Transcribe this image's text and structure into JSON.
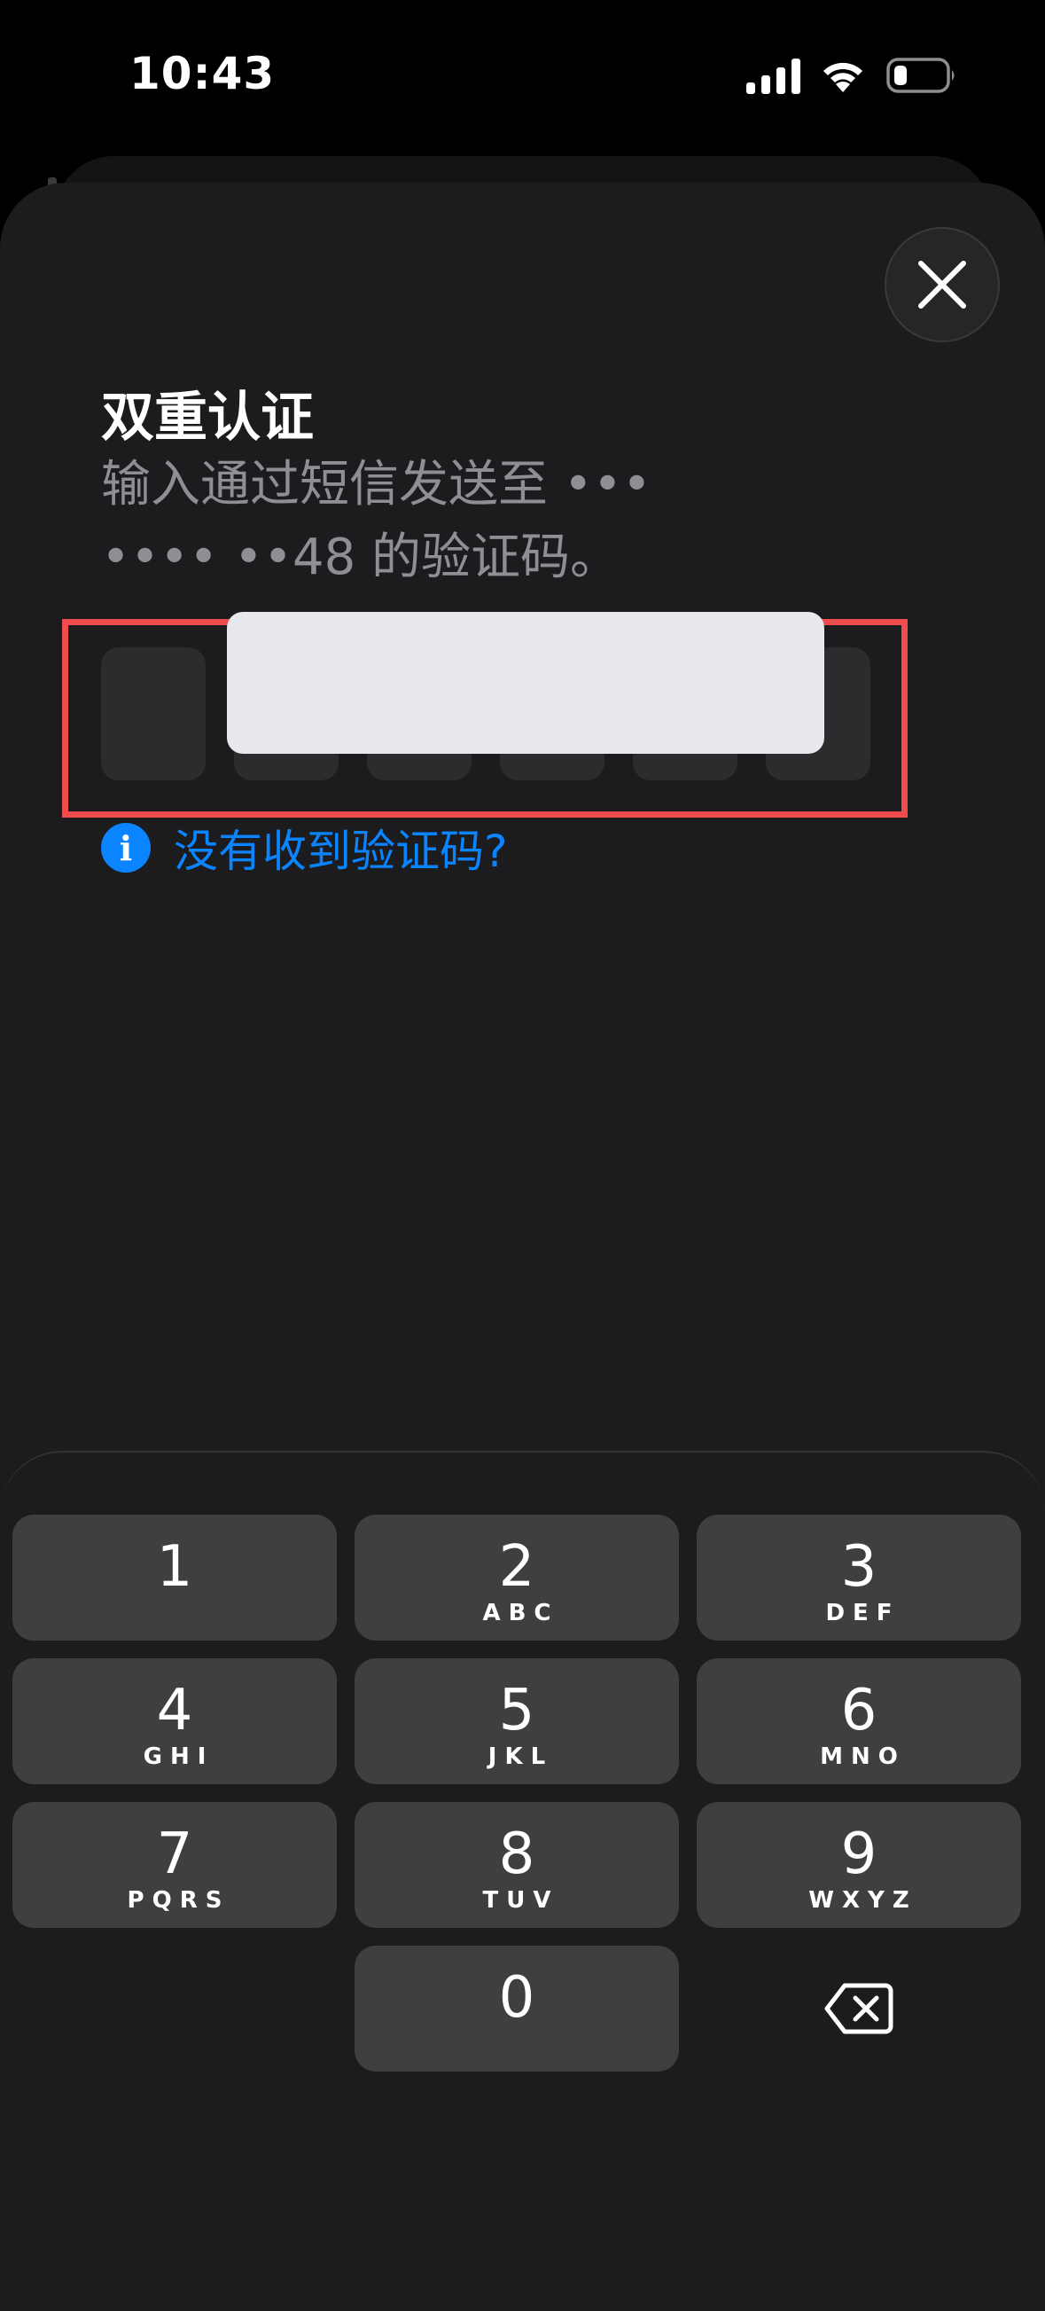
{
  "status_bar": {
    "time": "10:43"
  },
  "dialog": {
    "title": "双重认证",
    "subtitle": "输入通过短信发送至 •••\n•••• ••48 的验证码。",
    "help_link": "没有收到验证码?",
    "help_icon_glyph": "i"
  },
  "icons": {
    "close": "close-icon",
    "info": "info-icon",
    "delete": "backspace-icon",
    "signal": "cellular-signal-icon",
    "wifi": "wifi-icon",
    "battery": "battery-icon"
  },
  "colors": {
    "background": "#000000",
    "sheet": "#1c1c1e",
    "code_box": "#2c2c2e",
    "highlight_border": "#ee4c4f",
    "link": "#0a84ff",
    "key": "#3f3f41",
    "secondary_text": "#8e8e93"
  },
  "keypad": {
    "keys": [
      {
        "digit": "1",
        "letters": ""
      },
      {
        "digit": "2",
        "letters": "ABC"
      },
      {
        "digit": "3",
        "letters": "DEF"
      },
      {
        "digit": "4",
        "letters": "GHI"
      },
      {
        "digit": "5",
        "letters": "JKL"
      },
      {
        "digit": "6",
        "letters": "MNO"
      },
      {
        "digit": "7",
        "letters": "PQRS"
      },
      {
        "digit": "8",
        "letters": "TUV"
      },
      {
        "digit": "9",
        "letters": "WXYZ"
      },
      {
        "digit": "0",
        "letters": ""
      }
    ]
  }
}
